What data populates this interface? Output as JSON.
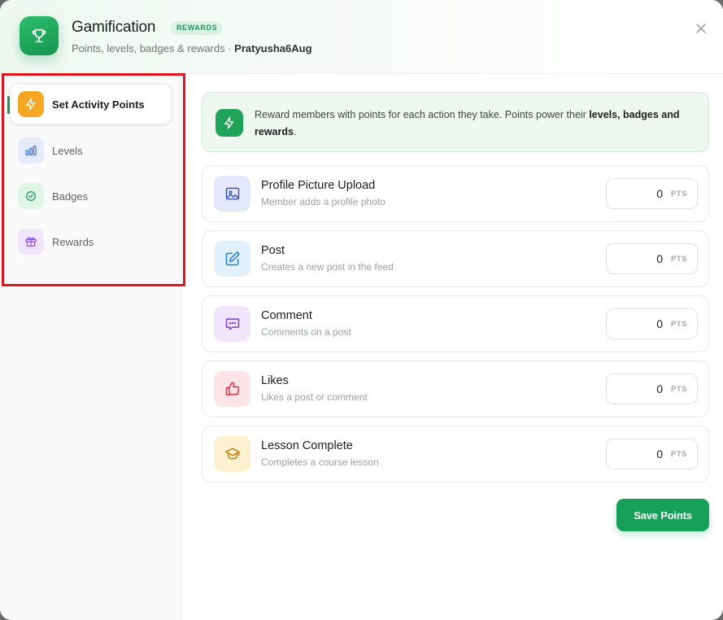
{
  "header": {
    "title": "Gamification",
    "badge": "REWARDS",
    "subtitle_prefix": "Points, levels, badges & rewards · ",
    "username": "Pratyusha6Aug",
    "app_icon": "trophy-icon",
    "close_icon": "close-icon"
  },
  "sidebar": {
    "items": [
      {
        "label": "Set Activity Points",
        "icon": "lightning-icon",
        "active": true
      },
      {
        "label": "Levels",
        "icon": "bar-chart-icon",
        "active": false
      },
      {
        "label": "Badges",
        "icon": "badge-check-icon",
        "active": false
      },
      {
        "label": "Rewards",
        "icon": "gift-icon",
        "active": false
      }
    ]
  },
  "info": {
    "text_prefix": "Reward members with points for each action they take. Points power their ",
    "text_bold": "levels, badges and rewards",
    "text_suffix": "."
  },
  "activities": [
    {
      "title": "Profile Picture Upload",
      "desc": "Member adds a profile photo",
      "value": "0",
      "unit": "PTS",
      "icon": "image-icon"
    },
    {
      "title": "Post",
      "desc": "Creates a new post in the feed",
      "value": "0",
      "unit": "PTS",
      "icon": "edit-icon"
    },
    {
      "title": "Comment",
      "desc": "Comments on a post",
      "value": "0",
      "unit": "PTS",
      "icon": "comment-icon"
    },
    {
      "title": "Likes",
      "desc": "Likes a post or comment",
      "value": "0",
      "unit": "PTS",
      "icon": "thumbs-up-icon"
    },
    {
      "title": "Lesson Complete",
      "desc": "Completes a course lesson",
      "value": "0",
      "unit": "PTS",
      "icon": "graduation-cap-icon"
    }
  ],
  "save_label": "Save Points",
  "colors": {
    "accent": "#17a058",
    "highlight_border": "#e0141b"
  }
}
